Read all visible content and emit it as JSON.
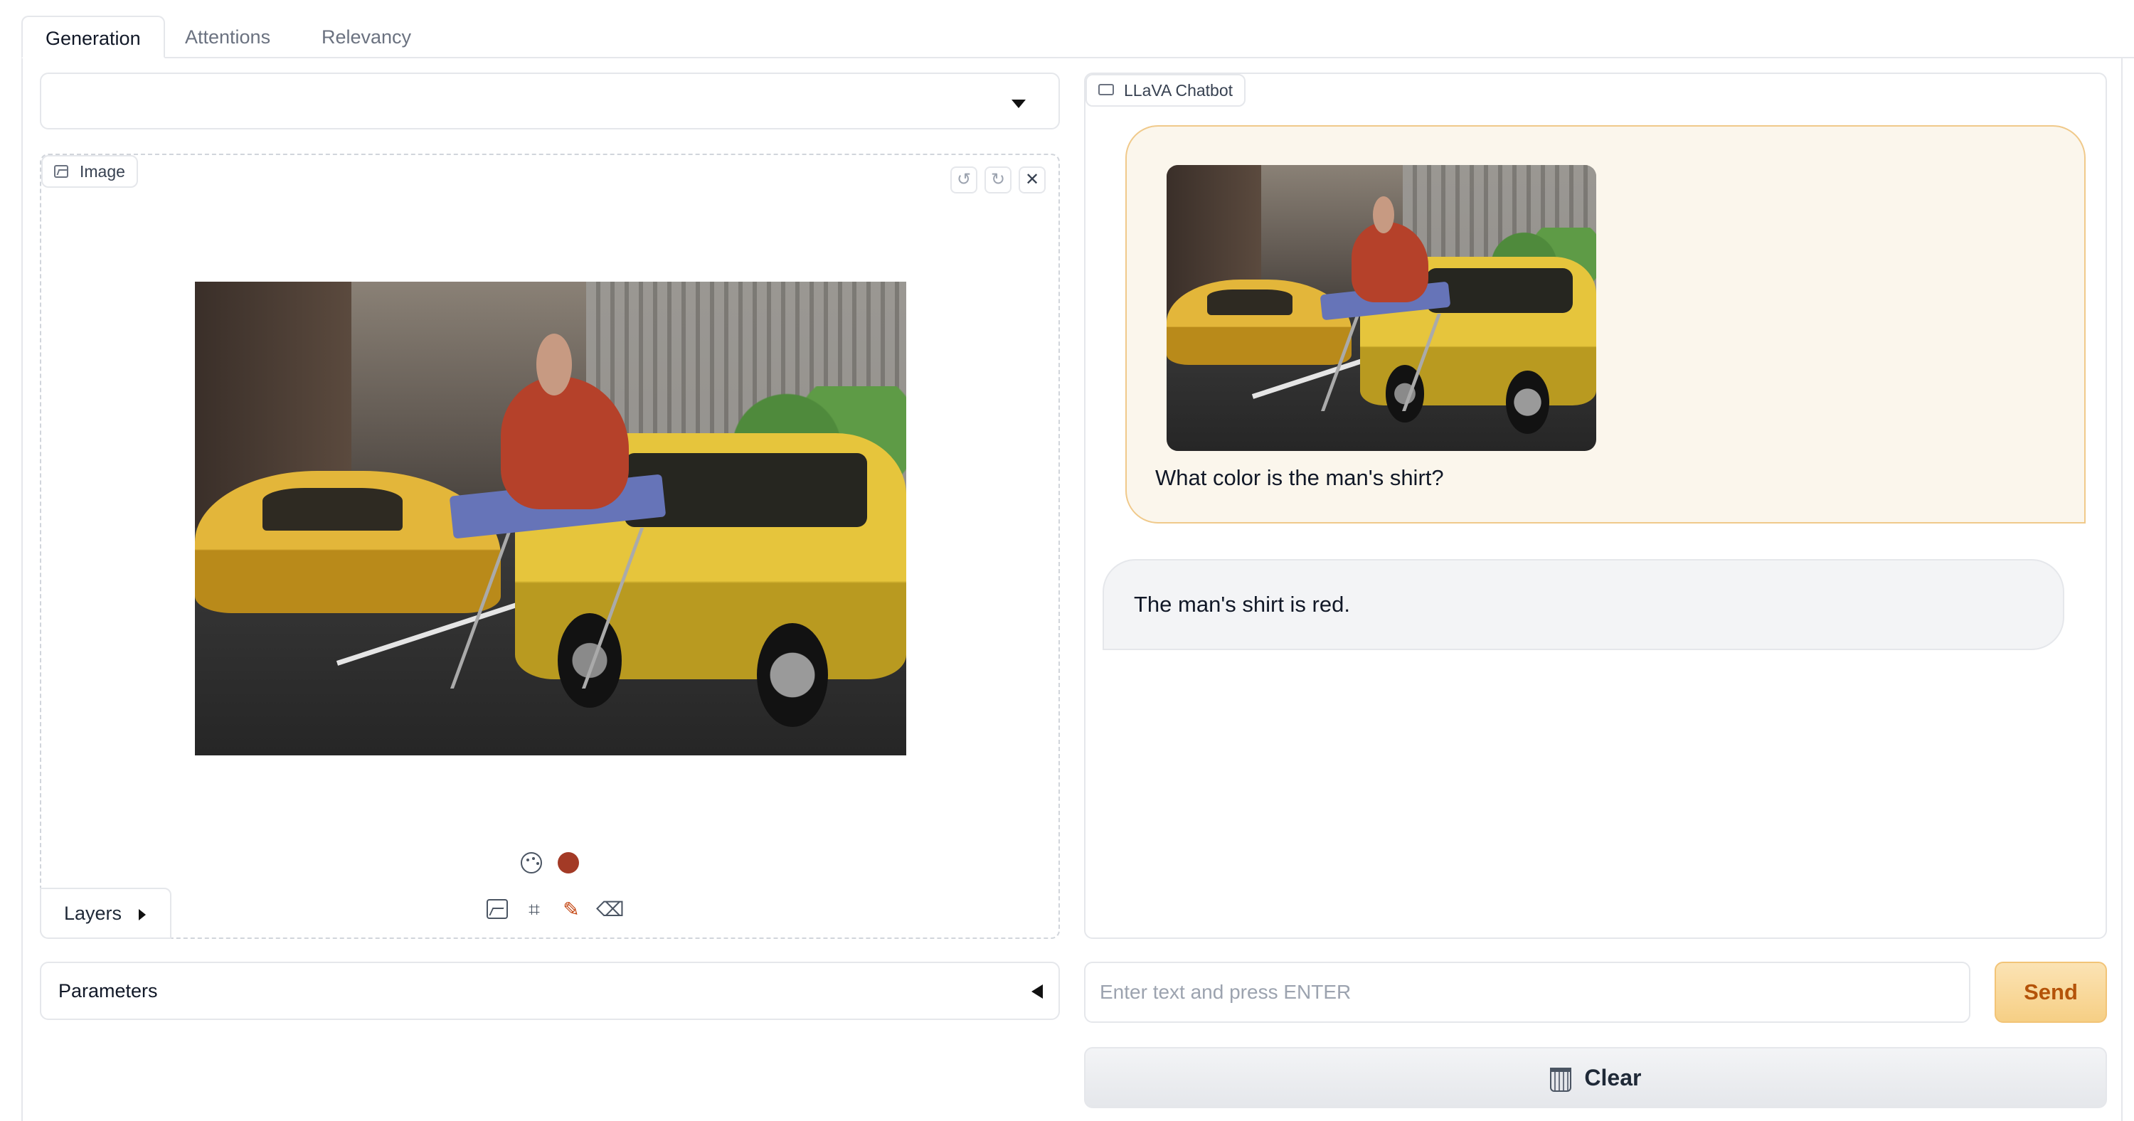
{
  "tabs": [
    {
      "label": "Generation",
      "active": true
    },
    {
      "label": "Attentions",
      "active": false
    },
    {
      "label": "Relevancy",
      "active": false
    }
  ],
  "model_dropdown": {
    "value": ""
  },
  "image_editor": {
    "label": "Image",
    "label_icon": "image-icon",
    "toolbar_icons": [
      "undo-icon",
      "redo-icon",
      "close-icon"
    ],
    "brush_color": "#a33a26",
    "tools": [
      "image-upload-icon",
      "crop-icon",
      "brush-icon",
      "eraser-icon"
    ],
    "layers_label": "Layers"
  },
  "parameters": {
    "label": "Parameters"
  },
  "chatbot": {
    "label": "LLaVA Chatbot",
    "label_icon": "chat-icon",
    "messages": [
      {
        "role": "user",
        "text": "What color is the man's shirt?",
        "has_image": true
      },
      {
        "role": "assistant",
        "text": "The man's shirt is red."
      }
    ]
  },
  "input": {
    "placeholder": "Enter text and press ENTER",
    "value": ""
  },
  "send_label": "Send",
  "clear_label": "Clear",
  "clear_icon": "wastebasket-icon",
  "colors": {
    "accent": "#f6cf85",
    "user_bubble_border": "#f0c98a",
    "shirt_red": "#a33a26"
  }
}
